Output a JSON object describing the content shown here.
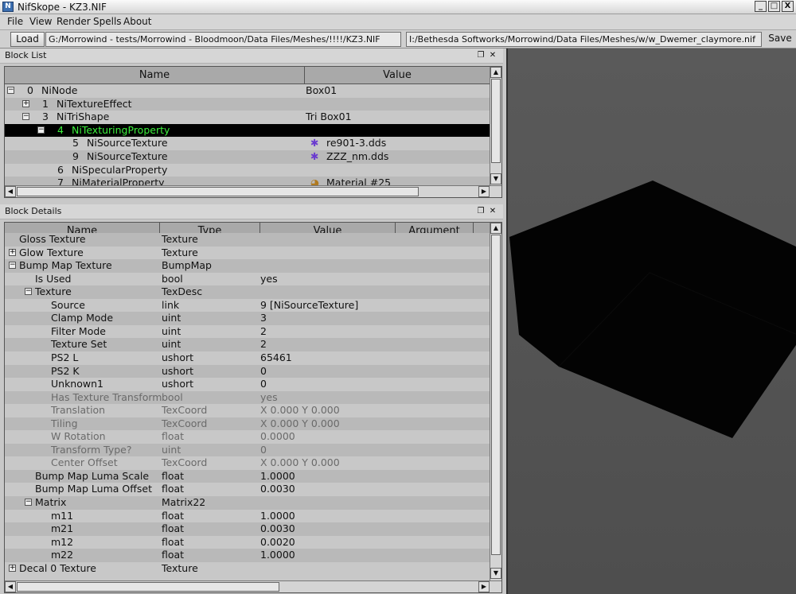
{
  "window": {
    "title": "NifSkope - KZ3.NIF",
    "app_icon": "nifskope-app-icon",
    "minimize": "_",
    "maximize": "□",
    "close": "X"
  },
  "menu": [
    "File",
    "View",
    "Render",
    "Spells",
    "About"
  ],
  "toolbar": {
    "load_label": "Load",
    "load_path": "G:/Morrowind - tests/Morrowind - Bloodmoon/Data Files/Meshes/!!!!/KZ3.NIF",
    "save_path": "I:/Bethesda Softworks/Morrowind/Data Files/Meshes/w/w_Dwemer_claymore.nif",
    "save_label": "Save"
  },
  "block_list": {
    "title": "Block List",
    "float_icon": "❐",
    "close_icon": "✕",
    "columns": [
      "Name",
      "Value"
    ],
    "rows": [
      {
        "expander": "−",
        "index": "0",
        "name": "NiNode",
        "value": "Box01"
      },
      {
        "expander": "+",
        "index": "1",
        "name": "NiTextureEffect",
        "value": ""
      },
      {
        "expander": "−",
        "index": "3",
        "name": "NiTriShape",
        "value": "Tri Box01"
      },
      {
        "expander": "−",
        "index": "4",
        "name": "NiTexturingProperty",
        "value": ""
      },
      {
        "expander": "",
        "index": "5",
        "name": "NiSourceTexture",
        "value": "re901-3.dds",
        "icon": "texture-star-icon"
      },
      {
        "expander": "",
        "index": "9",
        "name": "NiSourceTexture",
        "value": "ZZZ_nm.dds",
        "icon": "texture-star-icon"
      },
      {
        "expander": "",
        "index": "6",
        "name": "NiSpecularProperty",
        "value": ""
      },
      {
        "expander": "",
        "index": "7",
        "name": "NiMaterialProperty",
        "value": "Material #25",
        "icon": "material-palette-icon"
      }
    ]
  },
  "block_details": {
    "title": "Block Details",
    "float_icon": "❐",
    "close_icon": "✕",
    "columns": [
      "Name",
      "Type",
      "Value",
      "Argument"
    ],
    "rows": [
      {
        "expander": "",
        "name": "Gloss Texture",
        "type": "Texture",
        "value": "",
        "dim": false
      },
      {
        "expander": "+",
        "name": "Glow Texture",
        "type": "Texture",
        "value": "",
        "dim": false
      },
      {
        "expander": "−",
        "name": "Bump Map Texture",
        "type": "BumpMap",
        "value": "",
        "dim": false
      },
      {
        "expander": "",
        "name": "Is Used",
        "type": "bool",
        "value": "yes",
        "dim": false
      },
      {
        "expander": "−",
        "name": "Texture",
        "type": "TexDesc",
        "value": "",
        "dim": false
      },
      {
        "expander": "",
        "name": "Source",
        "type": "link",
        "value": "9 [NiSourceTexture]",
        "dim": false
      },
      {
        "expander": "",
        "name": "Clamp Mode",
        "type": "uint",
        "value": "3",
        "dim": false
      },
      {
        "expander": "",
        "name": "Filter Mode",
        "type": "uint",
        "value": "2",
        "dim": false
      },
      {
        "expander": "",
        "name": "Texture Set",
        "type": "uint",
        "value": "2",
        "dim": false
      },
      {
        "expander": "",
        "name": "PS2 L",
        "type": "ushort",
        "value": "65461",
        "dim": false
      },
      {
        "expander": "",
        "name": "PS2 K",
        "type": "ushort",
        "value": "0",
        "dim": false
      },
      {
        "expander": "",
        "name": "Unknown1",
        "type": "ushort",
        "value": "0",
        "dim": false
      },
      {
        "expander": "",
        "name": "Has Texture Transform",
        "type": "bool",
        "value": "yes",
        "dim": true
      },
      {
        "expander": "",
        "name": "Translation",
        "type": "TexCoord",
        "value": "X 0.000 Y 0.000",
        "dim": true
      },
      {
        "expander": "",
        "name": "Tiling",
        "type": "TexCoord",
        "value": "X 0.000 Y 0.000",
        "dim": true
      },
      {
        "expander": "",
        "name": "W Rotation",
        "type": "float",
        "value": "0.0000",
        "dim": true
      },
      {
        "expander": "",
        "name": "Transform Type?",
        "type": "uint",
        "value": "0",
        "dim": true
      },
      {
        "expander": "",
        "name": "Center Offset",
        "type": "TexCoord",
        "value": "X 0.000 Y 0.000",
        "dim": true
      },
      {
        "expander": "",
        "name": "Bump Map Luma Scale",
        "type": "float",
        "value": "1.0000",
        "dim": false
      },
      {
        "expander": "",
        "name": "Bump Map Luma Offset",
        "type": "float",
        "value": "0.0030",
        "dim": false
      },
      {
        "expander": "−",
        "name": "Matrix",
        "type": "Matrix22",
        "value": "",
        "dim": false
      },
      {
        "expander": "",
        "name": "m11",
        "type": "float",
        "value": "1.0000",
        "dim": false
      },
      {
        "expander": "",
        "name": "m21",
        "type": "float",
        "value": "0.0030",
        "dim": false
      },
      {
        "expander": "",
        "name": "m12",
        "type": "float",
        "value": "0.0020",
        "dim": false
      },
      {
        "expander": "",
        "name": "m22",
        "type": "float",
        "value": "1.0000",
        "dim": false
      },
      {
        "expander": "+",
        "name": "Decal 0 Texture",
        "type": "Texture",
        "value": "",
        "dim": false
      }
    ]
  },
  "scroll_arrows": {
    "up": "▲",
    "down": "▼",
    "left": "◀",
    "right": "▶"
  },
  "colors": {
    "selection_bg": "#000000",
    "selection_text": "#3cf03c",
    "viewport_bg": "#555555",
    "cube": "#050505"
  }
}
